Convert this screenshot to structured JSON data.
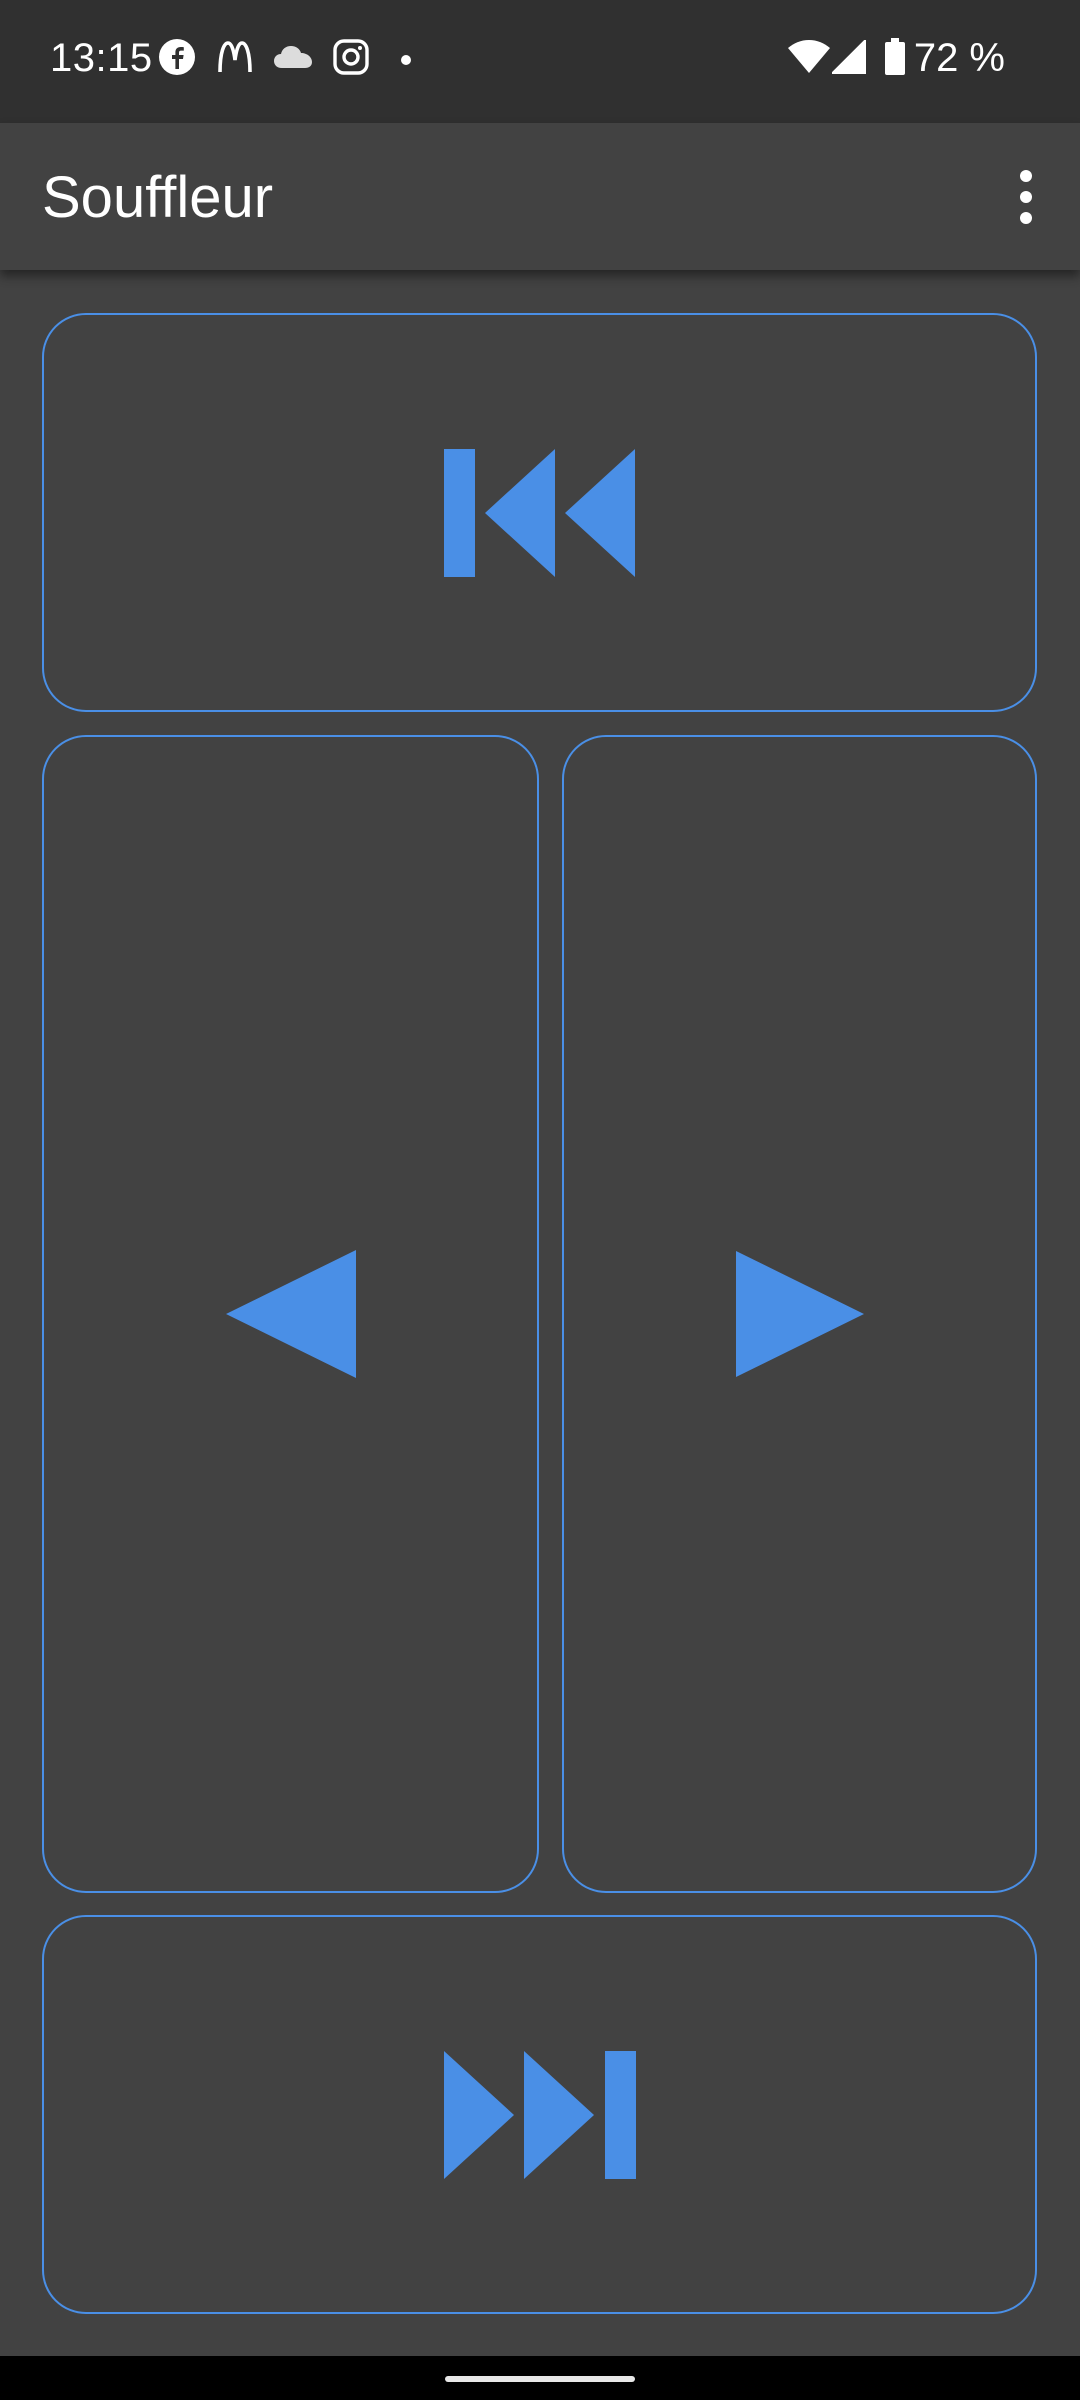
{
  "status_bar": {
    "time": "13:15",
    "battery_text": "72 %",
    "icons": [
      "facebook-icon",
      "mcdonalds-icon",
      "cloud-icon",
      "instagram-icon",
      "dot-icon",
      "wifi-icon",
      "signal-icon",
      "battery-icon"
    ]
  },
  "app_bar": {
    "title": "Souffleur",
    "menu_icon": "more-vert-icon"
  },
  "controls": {
    "first": {
      "icon": "skip-to-first-icon"
    },
    "previous": {
      "icon": "previous-icon"
    },
    "next": {
      "icon": "next-icon"
    },
    "last": {
      "icon": "skip-to-last-icon"
    }
  },
  "colors": {
    "accent": "#4a8fe6",
    "background": "#424242",
    "status_bar": "#303030",
    "nav_bar": "#000000"
  }
}
